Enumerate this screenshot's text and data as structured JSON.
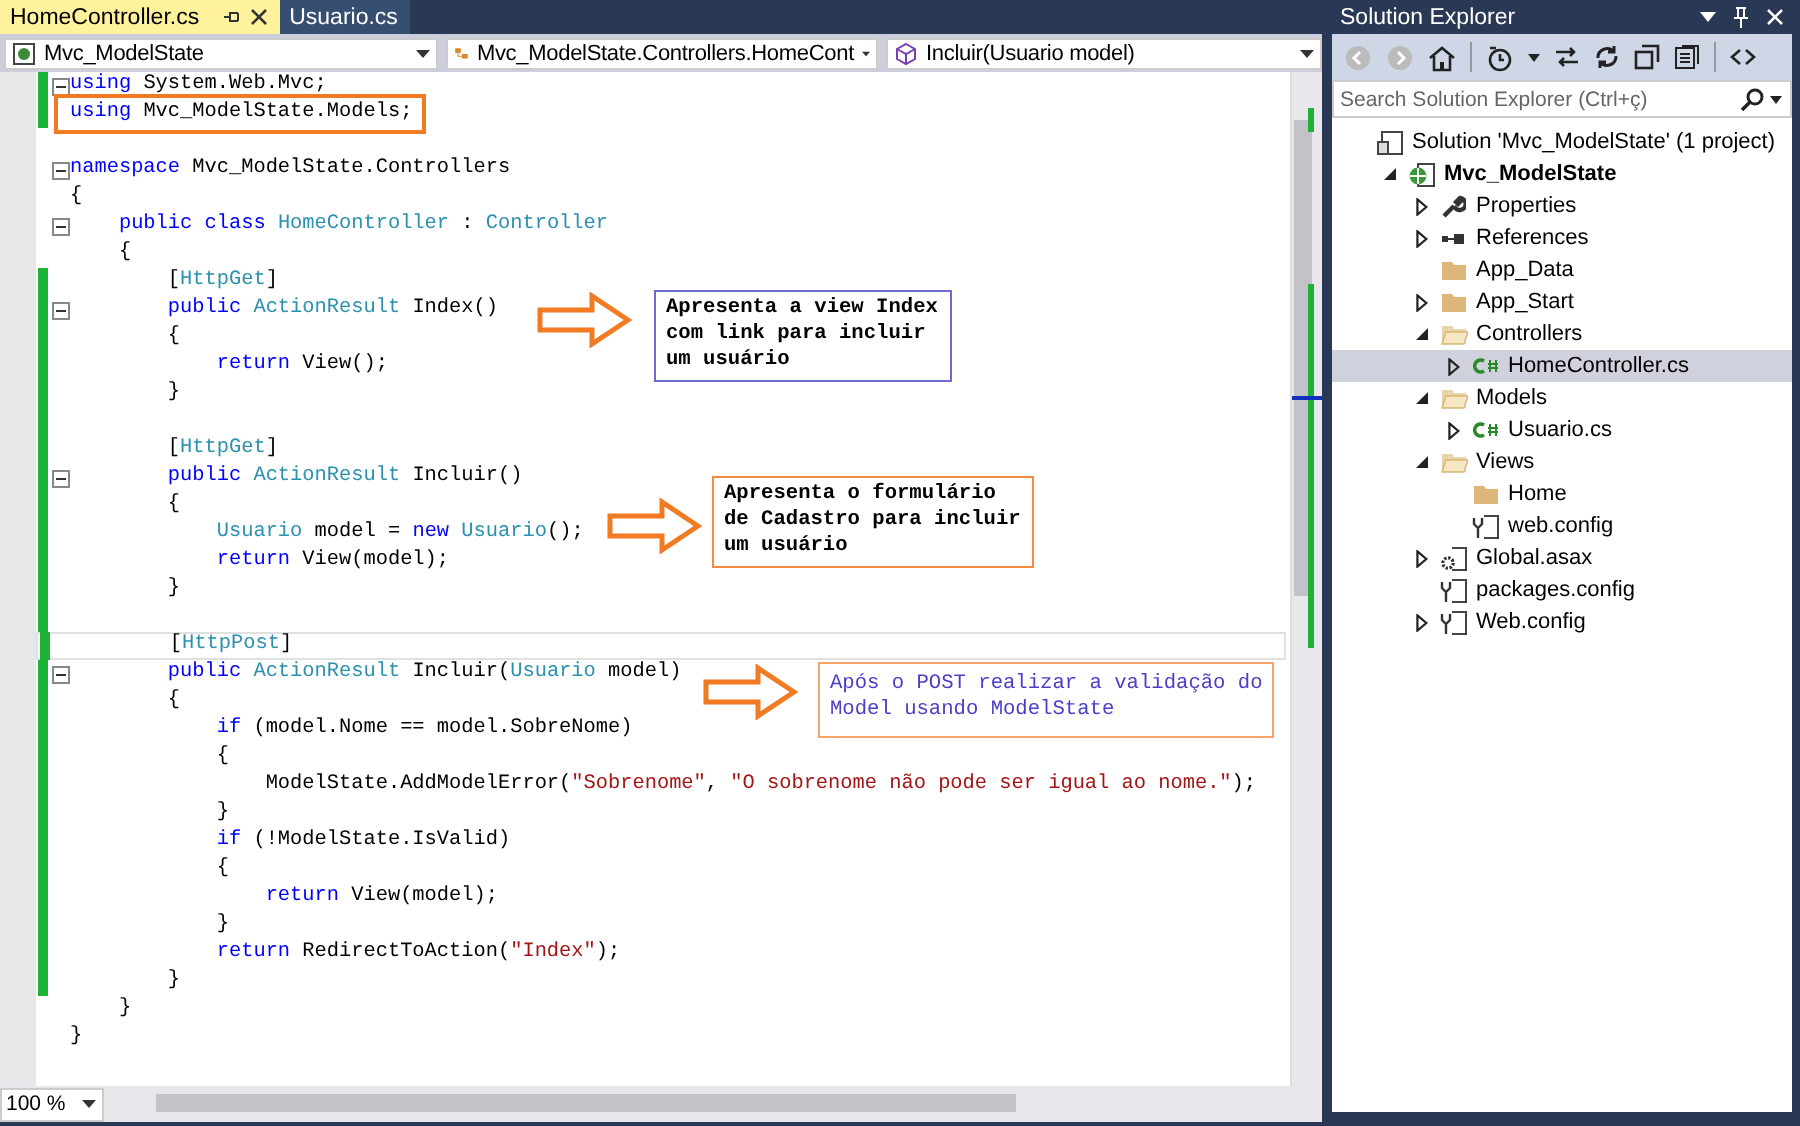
{
  "tabs": [
    {
      "label": "HomeController.cs",
      "selected": true
    },
    {
      "label": "Usuario.cs",
      "selected": false
    }
  ],
  "nav": [
    {
      "kind": "project",
      "text": "Mvc_ModelState"
    },
    {
      "kind": "class",
      "text": "Mvc_ModelState.Controllers.HomeCont"
    },
    {
      "kind": "method",
      "text": "Incluir(Usuario model)"
    }
  ],
  "code": {
    "lines": [
      {
        "tokens": [
          {
            "kind": "kw",
            "text": "using "
          },
          {
            "kind": "plain",
            "text": "System.Web.Mvc;"
          }
        ],
        "fold": true,
        "changed": true
      },
      {
        "tokens": [
          {
            "kind": "kw",
            "text": "using "
          },
          {
            "kind": "plain",
            "text": "Mvc_ModelState.Models;"
          }
        ],
        "changed": true,
        "boxed": true
      },
      {
        "changed": false
      },
      {
        "tokens": [
          {
            "kind": "kw",
            "text": "namespace "
          },
          {
            "kind": "plain",
            "text": "Mvc_ModelState.Controllers"
          }
        ],
        "fold": true
      },
      {
        "tokens": [
          {
            "kind": "plain",
            "text": "{"
          }
        ]
      },
      {
        "tokens": [
          {
            "kind": "kw",
            "text": "    public class "
          },
          {
            "kind": "type",
            "text": "HomeController"
          },
          {
            "kind": "plain",
            "text": " : "
          },
          {
            "kind": "type",
            "text": "Controller"
          }
        ],
        "fold": true
      },
      {
        "tokens": [
          {
            "kind": "plain",
            "text": "    {"
          }
        ]
      },
      {
        "tokens": [
          {
            "kind": "plain",
            "text": "        ["
          },
          {
            "kind": "type",
            "text": "HttpGet"
          },
          {
            "kind": "plain",
            "text": "]"
          }
        ],
        "changed": true
      },
      {
        "tokens": [
          {
            "kind": "kw",
            "text": "        public "
          },
          {
            "kind": "type",
            "text": "ActionResult"
          },
          {
            "kind": "plain",
            "text": " Index()"
          }
        ],
        "fold": true,
        "changed": true
      },
      {
        "tokens": [
          {
            "kind": "plain",
            "text": "        {"
          }
        ],
        "changed": true
      },
      {
        "tokens": [
          {
            "kind": "kw",
            "text": "            return"
          },
          {
            "kind": "plain",
            "text": " View();"
          }
        ],
        "changed": true
      },
      {
        "tokens": [
          {
            "kind": "plain",
            "text": "        }"
          }
        ],
        "changed": true
      },
      {
        "changed": true
      },
      {
        "tokens": [
          {
            "kind": "plain",
            "text": "        ["
          },
          {
            "kind": "type",
            "text": "HttpGet"
          },
          {
            "kind": "plain",
            "text": "]"
          }
        ],
        "changed": true
      },
      {
        "tokens": [
          {
            "kind": "kw",
            "text": "        public "
          },
          {
            "kind": "type",
            "text": "ActionResult"
          },
          {
            "kind": "plain",
            "text": " Incluir()"
          }
        ],
        "fold": true,
        "changed": true
      },
      {
        "tokens": [
          {
            "kind": "plain",
            "text": "        {"
          }
        ],
        "changed": true
      },
      {
        "tokens": [
          {
            "kind": "type",
            "text": "            Usuario"
          },
          {
            "kind": "plain",
            "text": " model = "
          },
          {
            "kind": "kw",
            "text": "new "
          },
          {
            "kind": "type",
            "text": "Usuario"
          },
          {
            "kind": "plain",
            "text": "();"
          }
        ],
        "changed": true
      },
      {
        "tokens": [
          {
            "kind": "kw",
            "text": "            return"
          },
          {
            "kind": "plain",
            "text": " View(model);"
          }
        ],
        "changed": true
      },
      {
        "tokens": [
          {
            "kind": "plain",
            "text": "        }"
          }
        ],
        "changed": true
      },
      {
        "changed": true
      },
      {
        "tokens": [
          {
            "kind": "plain",
            "text": "        ["
          },
          {
            "kind": "type",
            "text": "HttpPost"
          },
          {
            "kind": "plain",
            "text": "]"
          }
        ],
        "changed": true,
        "current": true
      },
      {
        "tokens": [
          {
            "kind": "kw",
            "text": "        public "
          },
          {
            "kind": "type",
            "text": "ActionResult"
          },
          {
            "kind": "plain",
            "text": " Incluir("
          },
          {
            "kind": "type",
            "text": "Usuario"
          },
          {
            "kind": "plain",
            "text": " model)"
          }
        ],
        "fold": true,
        "changed": true
      },
      {
        "tokens": [
          {
            "kind": "plain",
            "text": "        {"
          }
        ],
        "changed": true
      },
      {
        "tokens": [
          {
            "kind": "kw",
            "text": "            if"
          },
          {
            "kind": "plain",
            "text": " (model.Nome == model.SobreNome)"
          }
        ],
        "changed": true
      },
      {
        "tokens": [
          {
            "kind": "plain",
            "text": "            {"
          }
        ],
        "changed": true
      },
      {
        "tokens": [
          {
            "kind": "plain",
            "text": "                ModelState.AddModelError("
          },
          {
            "kind": "str",
            "text": "\"Sobrenome\""
          },
          {
            "kind": "plain",
            "text": ", "
          },
          {
            "kind": "str",
            "text": "\"O sobrenome não pode ser igual ao nome.\""
          },
          {
            "kind": "plain",
            "text": ");"
          }
        ],
        "changed": true
      },
      {
        "tokens": [
          {
            "kind": "plain",
            "text": "            }"
          }
        ],
        "changed": true
      },
      {
        "tokens": [
          {
            "kind": "kw",
            "text": "            if"
          },
          {
            "kind": "plain",
            "text": " (!ModelState.IsValid)"
          }
        ],
        "changed": true
      },
      {
        "tokens": [
          {
            "kind": "plain",
            "text": "            {"
          }
        ],
        "changed": true
      },
      {
        "tokens": [
          {
            "kind": "kw",
            "text": "                return"
          },
          {
            "kind": "plain",
            "text": " View(model);"
          }
        ],
        "changed": true
      },
      {
        "tokens": [
          {
            "kind": "plain",
            "text": "            }"
          }
        ],
        "changed": true
      },
      {
        "tokens": [
          {
            "kind": "kw",
            "text": "            return"
          },
          {
            "kind": "plain",
            "text": " RedirectToAction("
          },
          {
            "kind": "str",
            "text": "\"Index\""
          },
          {
            "kind": "plain",
            "text": ");"
          }
        ],
        "changed": true
      },
      {
        "tokens": [
          {
            "kind": "plain",
            "text": "        }"
          }
        ],
        "changed": true
      },
      {
        "tokens": [
          {
            "kind": "plain",
            "text": "    }"
          }
        ]
      },
      {
        "tokens": [
          {
            "kind": "plain",
            "text": "}"
          }
        ]
      }
    ]
  },
  "callouts": [
    {
      "kind": "bold",
      "color": "#6b6bd0",
      "lines": [
        "Apresenta a view Index",
        "com link para incluir",
        "um usuário"
      ]
    },
    {
      "kind": "bold",
      "color": "#f58a3c",
      "lines": [
        "Apresenta o formulário",
        "de Cadastro para incluir",
        "um usuário"
      ]
    },
    {
      "kind": "regular",
      "color": "#f5a46a",
      "lines": [
        "Após o POST realizar a validação do",
        "Model usando ModelState"
      ]
    }
  ],
  "zoom": "100 %",
  "solution": {
    "title": "Solution Explorer",
    "search": {
      "placeholder": "Search Solution Explorer (Ctrl+ç)"
    },
    "tree": [
      {
        "label": "Solution 'Mvc_ModelState' (1 project)",
        "kind": "solution",
        "selected": false,
        "children": [
          {
            "label": "Mvc_ModelState",
            "kind": "project",
            "bold": true,
            "expanded": true,
            "selected": false,
            "children": [
              {
                "label": "Properties",
                "kind": "wrench",
                "expanded": false,
                "selected": false
              },
              {
                "label": "References",
                "kind": "references",
                "expanded": false,
                "selected": false
              },
              {
                "label": "App_Data",
                "kind": "folder",
                "selected": false
              },
              {
                "label": "App_Start",
                "kind": "folder",
                "expanded": false,
                "selected": false
              },
              {
                "label": "Controllers",
                "kind": "folder",
                "expanded": true,
                "selected": false,
                "children": [
                  {
                    "label": "HomeController.cs",
                    "kind": "cs",
                    "expanded": false,
                    "selected": true
                  }
                ]
              },
              {
                "label": "Models",
                "kind": "folder",
                "expanded": true,
                "selected": false,
                "children": [
                  {
                    "label": "Usuario.cs",
                    "kind": "cs",
                    "expanded": false,
                    "selected": false
                  }
                ]
              },
              {
                "label": "Views",
                "kind": "folder",
                "expanded": true,
                "selected": false,
                "children": [
                  {
                    "label": "Home",
                    "kind": "folder",
                    "selected": false
                  },
                  {
                    "label": "web.config",
                    "kind": "config",
                    "selected": false
                  }
                ]
              },
              {
                "label": "Global.asax",
                "kind": "asax",
                "expanded": false,
                "selected": false
              },
              {
                "label": "packages.config",
                "kind": "config",
                "selected": false
              },
              {
                "label": "Web.config",
                "kind": "config",
                "expanded": false,
                "selected": false
              }
            ]
          }
        ]
      }
    ]
  }
}
